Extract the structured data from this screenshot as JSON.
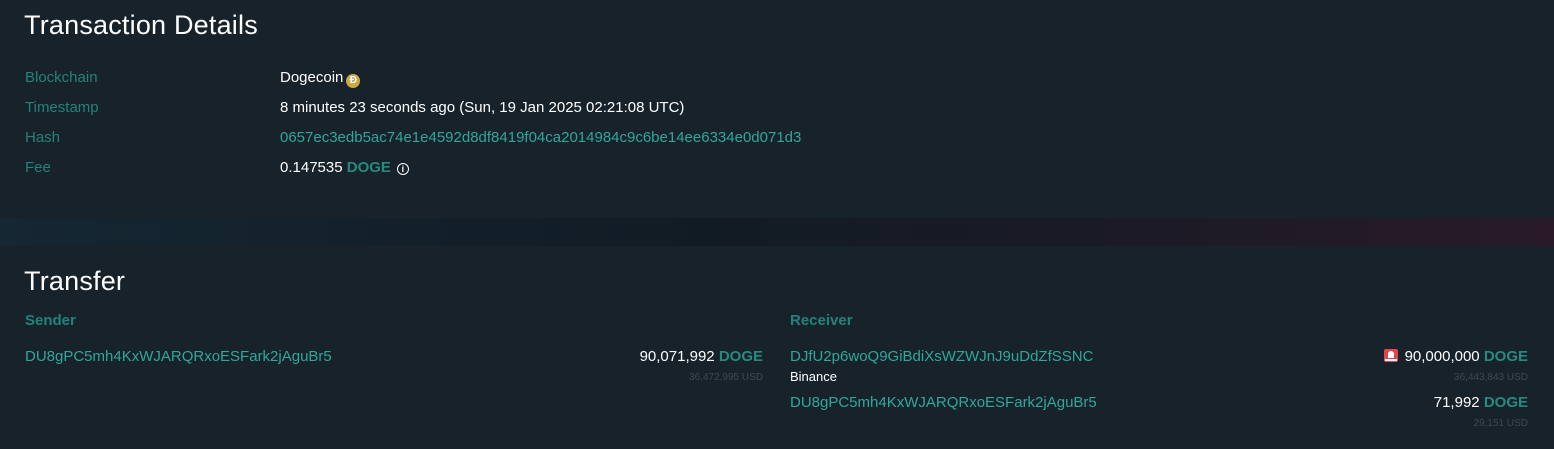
{
  "details": {
    "title": "Transaction Details",
    "blockchain": {
      "label": "Blockchain",
      "value": "Dogecoin",
      "icon": "dogecoin-icon"
    },
    "timestamp": {
      "label": "Timestamp",
      "value": "8 minutes 23 seconds ago (Sun, 19 Jan 2025 02:21:08 UTC)"
    },
    "hash": {
      "label": "Hash",
      "value": "0657ec3edb5ac74e1e4592d8df8419f04ca2014984c9c6be14ee6334e0d071d3"
    },
    "fee": {
      "label": "Fee",
      "amount": "0.147535",
      "unit": "DOGE",
      "icon": "info-icon"
    }
  },
  "transfer": {
    "title": "Transfer",
    "sender_header": "Sender",
    "receiver_header": "Receiver",
    "senders": [
      {
        "address": "DU8gPC5mh4KxWJARQRxoESFark2jAguBr5",
        "amount": "90,071,992",
        "unit": "DOGE",
        "usd": "36,472,995 USD"
      }
    ],
    "receivers": [
      {
        "address": "DJfU2p6woQ9GiBdiXsWZWJnJ9uDdZfSSNC",
        "owner": "Binance",
        "amount": "90,000,000",
        "unit": "DOGE",
        "usd": "36,443,843 USD",
        "icon": "alarm-icon"
      },
      {
        "address": "DU8gPC5mh4KxWJARQRxoESFark2jAguBr5",
        "amount": "71,992",
        "unit": "DOGE",
        "usd": "29,151 USD"
      }
    ]
  },
  "colors": {
    "background": "#17222b",
    "label": "#22837a",
    "link": "#2fa79a",
    "alert": "#e0474a"
  }
}
